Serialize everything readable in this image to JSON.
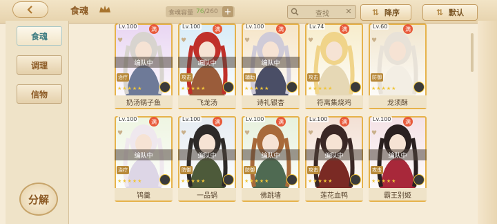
{
  "header": {
    "back_icon": "left-chevron-icon",
    "title": "食魂",
    "crown_icon": "crown-icon",
    "capacity_label": "食魂容量",
    "capacity_count": "76",
    "capacity_total": "/260",
    "add_label": "+",
    "search_placeholder": "查找",
    "clear_label": "✕",
    "sort_desc_label": "降序",
    "sort_default_label": "默认",
    "accent_color": "#3f7d82"
  },
  "sidebar": {
    "tabs": [
      {
        "label": "食魂",
        "active": true
      },
      {
        "label": "调理",
        "active": false
      },
      {
        "label": "信物",
        "active": false
      }
    ],
    "decompose_label": "分解"
  },
  "cards": [
    {
      "level": "Lv.100",
      "name": "奶汤锅子鱼",
      "team": "编队中",
      "role": "治疗",
      "bg": "#e9d6f2",
      "hair": "#d8d4cf",
      "robe": "#6e7a98"
    },
    {
      "level": "Lv.100",
      "name": "飞龙汤",
      "team": "编队中",
      "role": "攻击",
      "bg": "#d8ecf7",
      "hair": "#c0302a",
      "robe": "#9a5c3a"
    },
    {
      "level": "Lv.100",
      "name": "诗礼银杏",
      "team": "编队中",
      "role": "辅助",
      "bg": "#f6e5c8",
      "hair": "#cfcbd8",
      "robe": "#4a4e66"
    },
    {
      "level": "Lv.74",
      "name": "符离集烧鸡",
      "team": "",
      "role": "攻击",
      "bg": "#f7edcc",
      "hair": "#f0d48a",
      "robe": "#e6d8b5"
    },
    {
      "level": "Lv.60",
      "name": "龙须酥",
      "team": "",
      "role": "防御",
      "bg": "#f1e6cf",
      "hair": "#e8e2d8",
      "robe": "#f3eee4"
    },
    {
      "level": "Lv.100",
      "name": "鸨羹",
      "team": "编队中",
      "role": "治疗",
      "bg": "#eef5e2",
      "hair": "#efe8ee",
      "robe": "#ddd6e6"
    },
    {
      "level": "Lv.100",
      "name": "一品锅",
      "team": "编队中",
      "role": "防御",
      "bg": "#e6ecf2",
      "hair": "#2d2a28",
      "robe": "#4d5a3a"
    },
    {
      "level": "Lv.100",
      "name": "佛跳墙",
      "team": "编队中",
      "role": "防御",
      "bg": "#e7f1dd",
      "hair": "#a86a3a",
      "robe": "#4f6a52"
    },
    {
      "level": "Lv.100",
      "name": "莲花血鸭",
      "team": "编队中",
      "role": "攻击",
      "bg": "#f3e0d4",
      "hair": "#3a2724",
      "robe": "#7a2a24"
    },
    {
      "level": "Lv.100",
      "name": "霸王别姬",
      "team": "编队中",
      "role": "攻击",
      "bg": "#f4e2e6",
      "hair": "#2a2020",
      "robe": "#a8283a"
    }
  ],
  "stars": "★★★★★",
  "badge_label": "满"
}
